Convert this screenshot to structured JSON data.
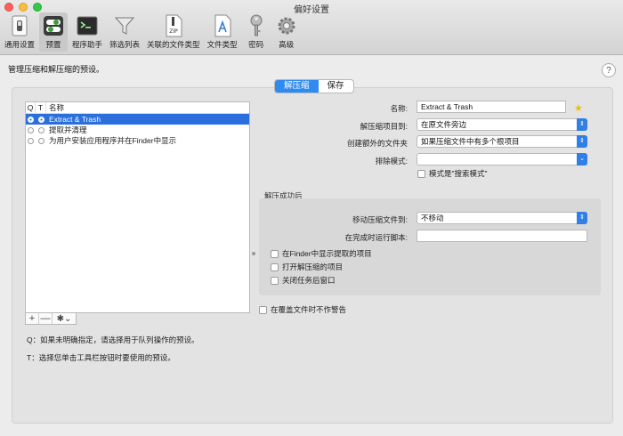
{
  "window": {
    "title": "偏好设置"
  },
  "toolbar": [
    {
      "label": "通用设置",
      "icon": "general-switch-icon"
    },
    {
      "label": "预置",
      "icon": "presets-icon"
    },
    {
      "label": "程序助手",
      "icon": "terminal-icon"
    },
    {
      "label": "筛选列表",
      "icon": "funnel-icon"
    },
    {
      "label": "关联的文件类型",
      "icon": "zip-document-icon"
    },
    {
      "label": "文件类型",
      "icon": "app-document-icon"
    },
    {
      "label": "密码",
      "icon": "key-icon"
    },
    {
      "label": "高级",
      "icon": "gear-icon"
    }
  ],
  "description": "管理压缩和解压缩的预设。",
  "help": "?",
  "tabs": {
    "extract": "解压缩",
    "save": "保存"
  },
  "table": {
    "headers": {
      "q": "Q",
      "t": "T",
      "name": "名称"
    },
    "rows": [
      {
        "name": "Extract & Trash"
      },
      {
        "name": "提取并清理"
      },
      {
        "name": "为用户安装应用程序并在Finder中显示"
      }
    ]
  },
  "table_buttons": {
    "add": "+",
    "remove": "—",
    "action": "✱⌄"
  },
  "notes": {
    "q": "Q：如果未明确指定，请选择用于队列操作的预设。",
    "t": "T：选择您单击工具栏按钮时要使用的预设。"
  },
  "form": {
    "name_label": "名称:",
    "name_value": "Extract & Trash",
    "extract_to_label": "解压缩项目到:",
    "extract_to_value": "在原文件旁边",
    "create_folder_label": "创建额外的文件夹",
    "create_folder_value": "如果压缩文件中有多个根项目",
    "exclude_label": "排除模式:",
    "exclude_value": "",
    "search_mode_label": "模式是\"搜索模式\"",
    "after_title": "解压成功后",
    "move_label": "移动压缩文件到:",
    "move_value": "不移动",
    "script_label": "在完成时运行脚本:",
    "script_value": "",
    "finder_label": "在Finder中显示提取的项目",
    "open_label": "打开解压缩的项目",
    "close_label": "关闭任务后窗口",
    "overwrite_label": "在覆盖文件时不作警告"
  },
  "colors": {
    "accent": "#2f8bf0",
    "selection": "#2a6fdb",
    "star": "#f0c000"
  }
}
